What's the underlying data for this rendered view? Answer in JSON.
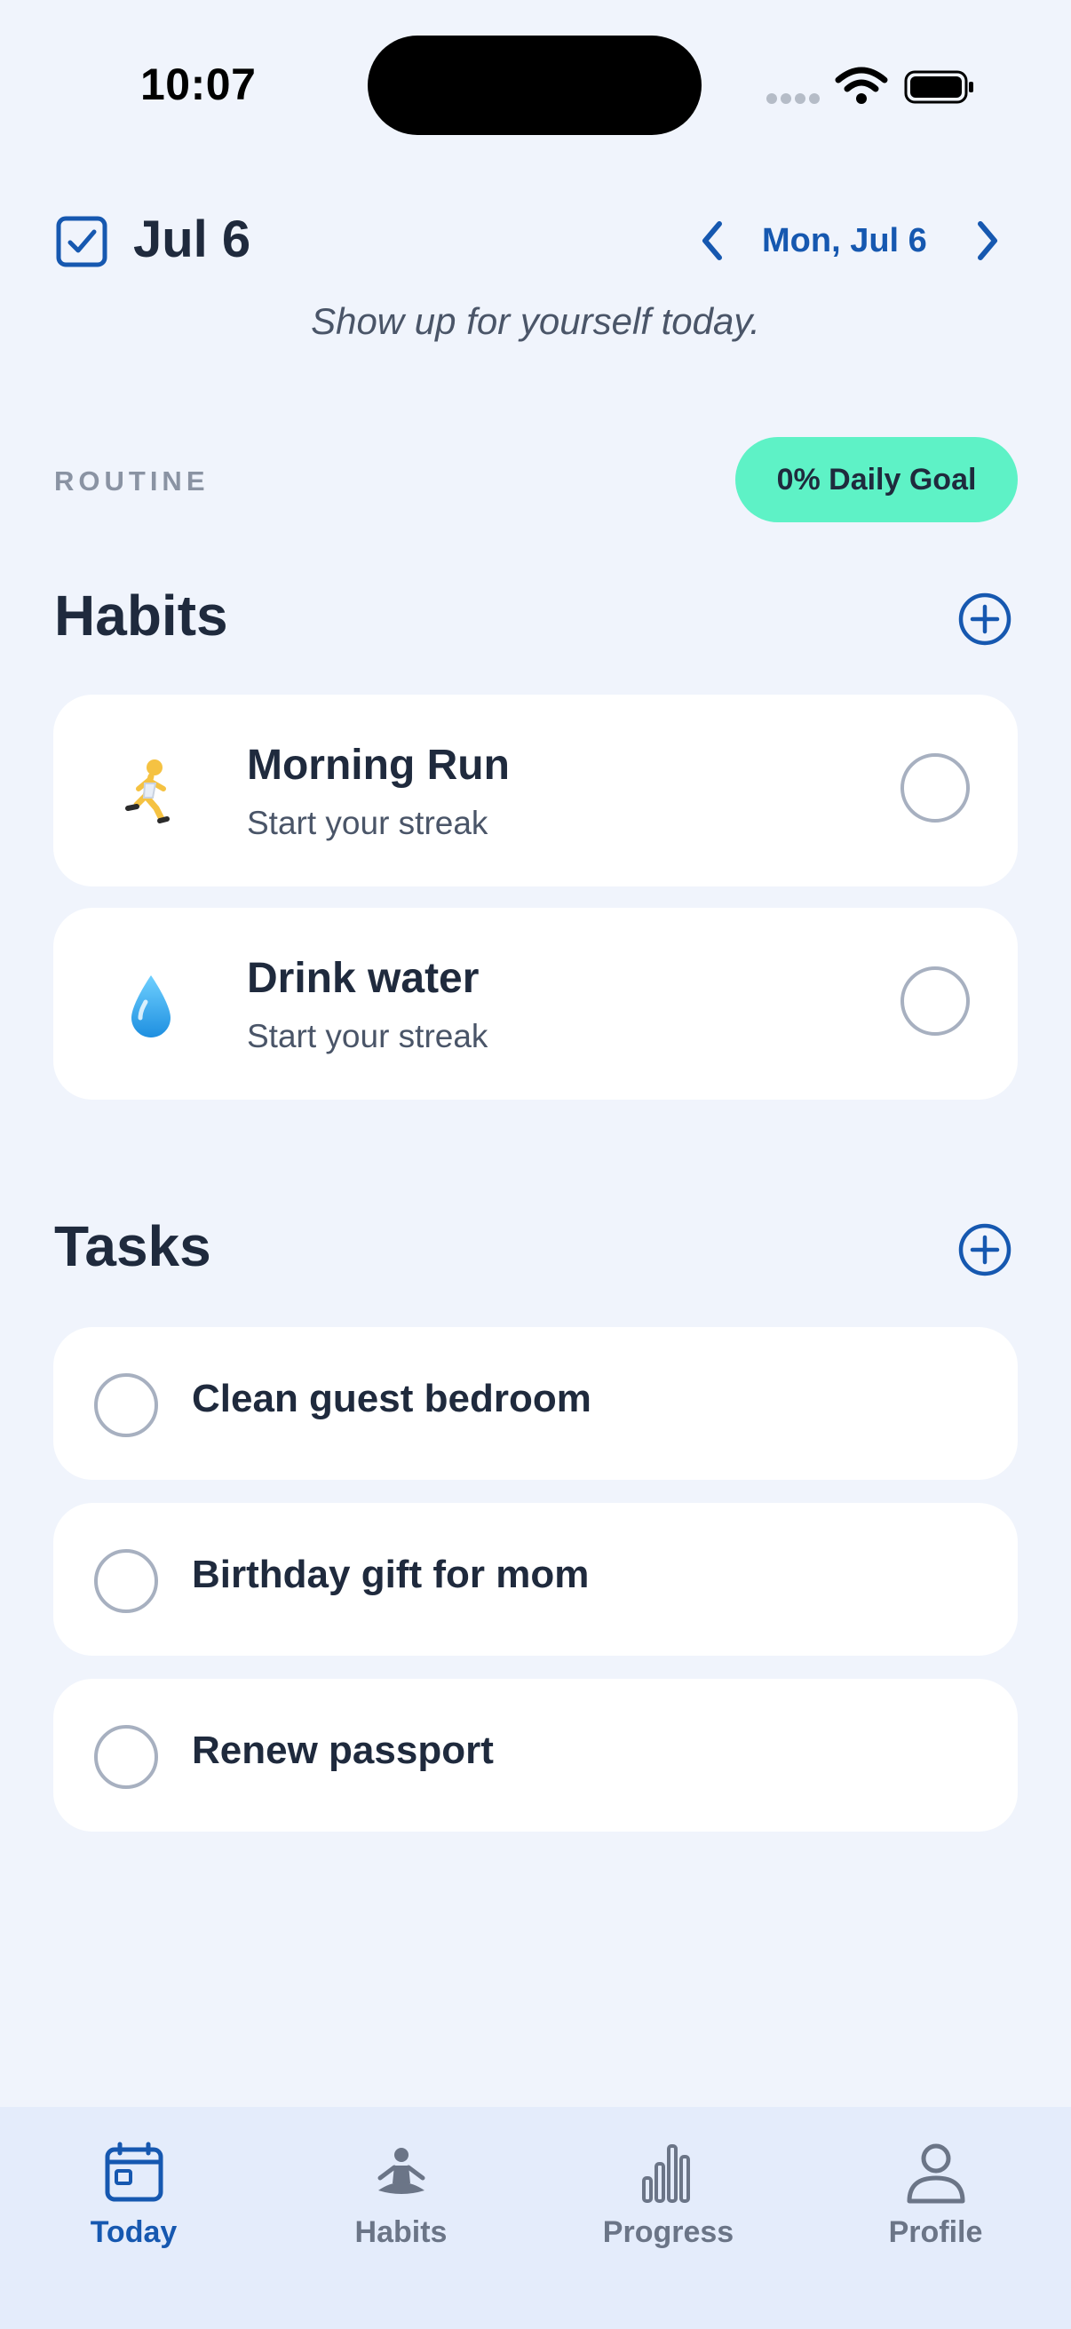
{
  "status_bar": {
    "time": "10:07"
  },
  "header": {
    "title": "Jul 6",
    "nav_date": "Mon, Jul 6",
    "tagline": "Show up for yourself today."
  },
  "routine": {
    "section_label": "ROUTINE",
    "goal_badge": "0% Daily Goal"
  },
  "habits": {
    "title": "Habits",
    "items": [
      {
        "emoji": "🏃",
        "icon": "running-person-icon",
        "name": "Morning Run",
        "subtitle": "Start your streak",
        "done": false
      },
      {
        "emoji": "💧",
        "icon": "water-drop-icon",
        "name": "Drink water",
        "subtitle": "Start your streak",
        "done": false
      }
    ]
  },
  "tasks": {
    "title": "Tasks",
    "items": [
      {
        "name": "Clean guest bedroom",
        "done": false
      },
      {
        "name": "Birthday gift for mom",
        "done": false
      },
      {
        "name": "Renew passport",
        "done": false
      }
    ]
  },
  "tab_bar": {
    "active": "Today",
    "tabs": [
      {
        "label": "Today",
        "icon": "calendar-icon"
      },
      {
        "label": "Habits",
        "icon": "meditation-icon"
      },
      {
        "label": "Progress",
        "icon": "bar-chart-icon"
      },
      {
        "label": "Profile",
        "icon": "person-icon"
      }
    ]
  },
  "colors": {
    "background": "#f0f4fc",
    "accent": "#1658b0",
    "goal_badge": "#5ef2c6",
    "card": "#ffffff",
    "tab_bar": "#e4ecfb"
  }
}
